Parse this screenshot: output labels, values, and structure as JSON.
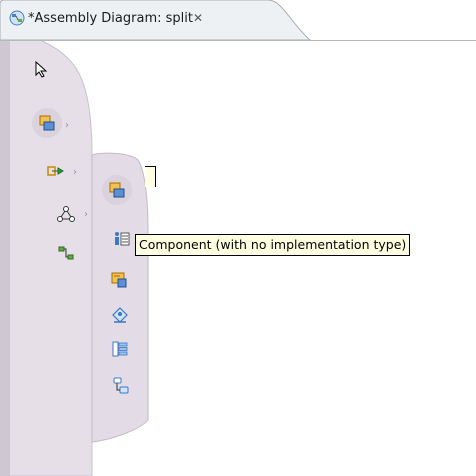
{
  "tab": {
    "title": "*Assembly Diagram: split",
    "close_glyph": "✕",
    "icon": "assembly-diagram-icon"
  },
  "palette": {
    "select_tool": "pointer-arrow-icon",
    "categories": [
      {
        "icon": "component-category-icon",
        "has_submenu": true,
        "selected": true
      },
      {
        "icon": "import-export-icon",
        "has_submenu": true
      },
      {
        "icon": "wiring-icon",
        "has_submenu": true
      },
      {
        "icon": "connection-icon",
        "has_submenu": false
      }
    ],
    "flyout_items": [
      "component-icon",
      "component-with-role-icon",
      "component-untyped-icon",
      "human-task-icon",
      "mediation-icon",
      "state-machine-icon"
    ]
  },
  "tooltip": {
    "text": "Component (with no implementation type)"
  },
  "colors": {
    "palette_bg": "#e6dfe8",
    "palette_edge": "#c9c0cc",
    "tooltip_bg": "#ffffe1",
    "icon_orange": "#e9a11a",
    "icon_blue": "#3a78c8"
  }
}
